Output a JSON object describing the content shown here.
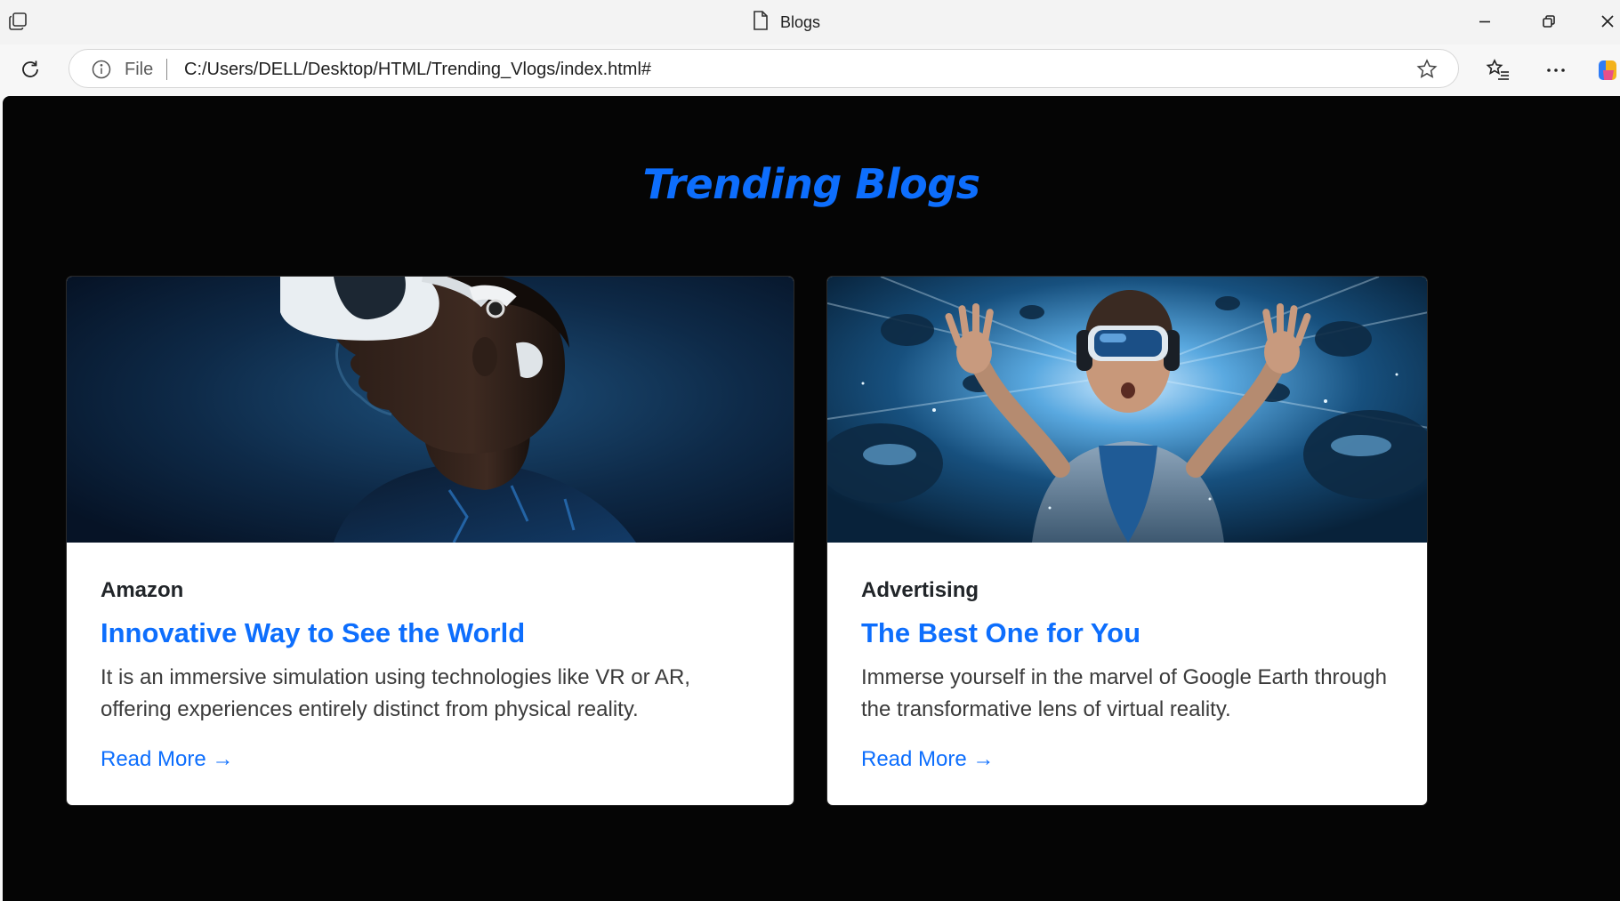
{
  "browser": {
    "tab_title": "Blogs",
    "url_scheme_label": "File",
    "url": "C:/Users/DELL/Desktop/HTML/Trending_Vlogs/index.html#"
  },
  "page": {
    "title": "Trending Blogs",
    "accent_color": "#0d6efd",
    "background_color": "#050505",
    "cards": [
      {
        "category": "Amazon",
        "title": "Innovative Way to See the World",
        "text": "It is an immersive simulation using technologies like VR or AR, offering experiences entirely distinct from physical reality.",
        "link": "Read More →",
        "image": "man-with-vr-headset"
      },
      {
        "category": "Advertising",
        "title": "The Best One for You",
        "text": "Immerse yourself in the marvel of Google Earth through the transformative lens of virtual reality.",
        "link": "Read More →",
        "image": "child-with-vr-headset"
      }
    ]
  }
}
